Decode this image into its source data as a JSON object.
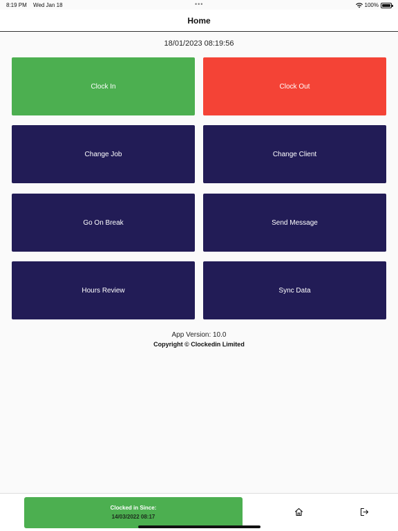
{
  "status_bar": {
    "time": "8:19 PM",
    "date": "Wed Jan 18",
    "battery": "100%"
  },
  "header": {
    "title": "Home"
  },
  "datetime": "18/01/2023 08:19:56",
  "tiles": {
    "clock_in": "Clock In",
    "clock_out": "Clock Out",
    "change_job": "Change Job",
    "change_client": "Change Client",
    "go_on_break": "Go On Break",
    "send_message": "Send Message",
    "hours_review": "Hours Review",
    "sync_data": "Sync Data"
  },
  "footer": {
    "app_version": "App Version: 10.0",
    "copyright": "Copyright © Clockedin Limited"
  },
  "bottom_bar": {
    "clocked_label": "Clocked in Since:",
    "clocked_time": "14/03/2022 08:17",
    "icons": [
      "home-icon",
      "logout-icon"
    ]
  },
  "colors": {
    "green": "#4caf50",
    "red": "#f44336",
    "navy": "#221c56"
  }
}
